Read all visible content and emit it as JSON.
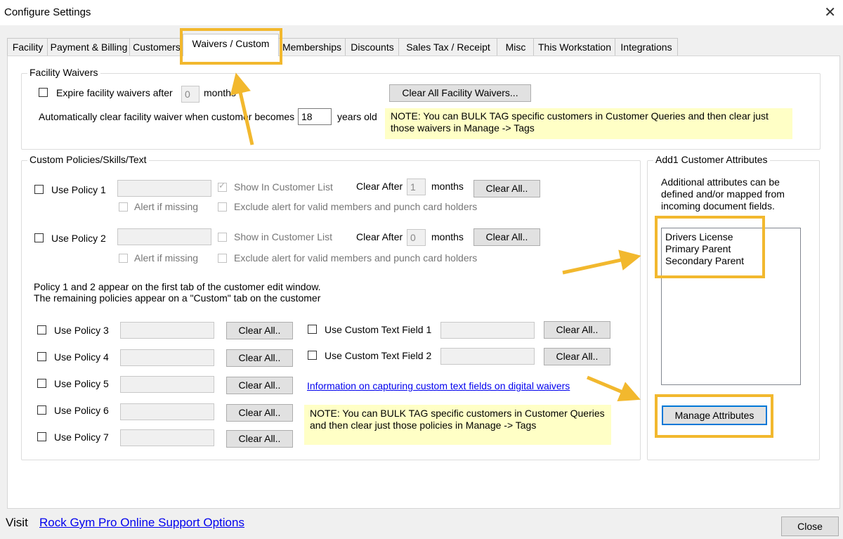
{
  "window": {
    "title": "Configure Settings",
    "close_glyph": "✕"
  },
  "tabs": [
    "Facility",
    "Payment & Billing",
    "Customers",
    "Waivers / Custom",
    "Memberships",
    "Discounts",
    "Sales Tax / Receipt",
    "Misc",
    "This Workstation",
    "Integrations"
  ],
  "active_tab": "Waivers / Custom",
  "facility_waivers": {
    "legend": "Facility Waivers",
    "expire_label": "Expire facility waivers after",
    "expire_value": "0",
    "months": "months",
    "clear_button": "Clear All Facility Waivers...",
    "auto_clear_label": "Automatically clear facility waiver when customer becomes",
    "age_value": "18",
    "years_old": "years old",
    "note": "NOTE:  You can BULK TAG specific customers in Customer Queries and then clear just those waivers in Manage -> Tags"
  },
  "custom_policies": {
    "legend": "Custom Policies/Skills/Text",
    "policy1": {
      "label": "Use Policy 1",
      "show_in_list": "Show In Customer List",
      "clear_after": "Clear After",
      "clear_after_value": "1",
      "months": "months",
      "clear_button": "Clear All..",
      "alert_missing": "Alert if missing",
      "exclude_alert": "Exclude alert for valid members and punch card holders"
    },
    "policy2": {
      "label": "Use Policy 2",
      "show_in_list": "Show in Customer List",
      "clear_after": "Clear After",
      "clear_after_value": "0",
      "months": "months",
      "clear_button": "Clear All..",
      "alert_missing": "Alert if missing",
      "exclude_alert": "Exclude alert for valid members and punch card holders"
    },
    "info_line1": "Policy 1 and 2 appear on the first tab of the customer edit window.",
    "info_line2": "The remaining policies appear on a \"Custom\" tab on the customer",
    "more_policies": [
      {
        "label": "Use Policy 3",
        "clear_button": "Clear All.."
      },
      {
        "label": "Use Policy 4",
        "clear_button": "Clear All.."
      },
      {
        "label": "Use Policy 5",
        "clear_button": "Clear All.."
      },
      {
        "label": "Use Policy 6",
        "clear_button": "Clear All.."
      },
      {
        "label": "Use Policy 7",
        "clear_button": "Clear All.."
      }
    ],
    "custom_text_fields": [
      {
        "label": "Use Custom Text Field 1",
        "clear_button": "Clear All.."
      },
      {
        "label": "Use Custom Text Field 2",
        "clear_button": "Clear All.."
      }
    ],
    "info_link": "Information on capturing custom text fields on digital waivers",
    "note": "NOTE:  You can BULK TAG specific customers in Customer Queries and then clear just those policies in Manage -> Tags"
  },
  "attributes": {
    "legend": "Add1 Customer Attributes",
    "description": [
      "Additional attributes can be",
      "defined and/or mapped from",
      "incoming document fields."
    ],
    "items": [
      "Drivers License",
      "Primary Parent",
      "Secondary Parent"
    ],
    "manage_button": "Manage Attributes"
  },
  "footer": {
    "visit": "Visit",
    "link": "Rock Gym Pro Online Support Options",
    "close_button": "Close"
  },
  "colors": {
    "highlight": "#f2b82e",
    "note_bg": "#ffffc6",
    "link": "#0000ee"
  }
}
